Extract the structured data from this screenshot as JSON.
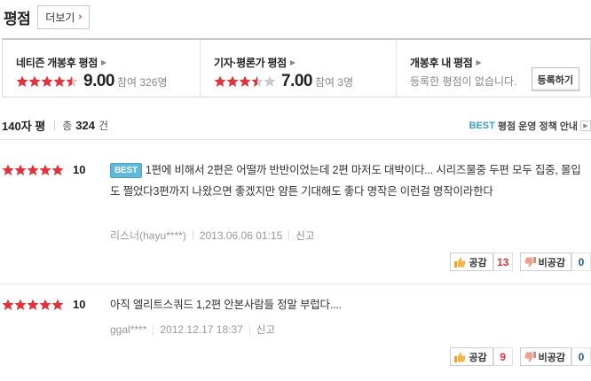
{
  "header": {
    "title": "평점",
    "more_label": "더보기"
  },
  "summary": {
    "netizen": {
      "label": "네티즌 개봉후 평점",
      "stars": 4.5,
      "score": "9.00",
      "count": "참여 326명"
    },
    "critic": {
      "label": "기자·평론가 평점",
      "stars": 3.5,
      "score": "7.00",
      "count": "참여 3명"
    },
    "mine": {
      "label": "개봉후 내 평점",
      "empty_text": "등록한 평점이 없습니다.",
      "register_label": "등록하기"
    }
  },
  "list": {
    "title": "140자 평",
    "total_prefix": "총",
    "total_count": "324",
    "total_suffix": "건",
    "policy_best": "BEST",
    "policy_text": "평점 운영 정책 안내"
  },
  "reviews": [
    {
      "stars": 5,
      "score": "10",
      "best_badge": "BEST",
      "text": "1편에 비해서 2편은 어떨까 반반이었는데 2편 마저도 대박이다... 시리즈물중 두편 모두 집중, 몰입도 쩔었다3편까지 나왔으면 좋겠지만 얌튼 기대해도 좋다 명작은 이런걸 명작이라한다",
      "author": "리스너(hayu****)",
      "date": "2013.06.06 01:15",
      "report": "신고",
      "like_label": "공감",
      "like_count": "13",
      "dislike_label": "비공감",
      "dislike_count": "0"
    },
    {
      "stars": 5,
      "score": "10",
      "text": "아직 엘리트스쿼드 1,2편 안본사람들 정말 부럽다....",
      "author": "ggal****",
      "date": "2012.12.17 18:37",
      "report": "신고",
      "like_label": "공감",
      "like_count": "9",
      "dislike_label": "비공감",
      "dislike_count": "0"
    }
  ],
  "colors": {
    "star_on": "#e2323b",
    "star_off": "#cccccc",
    "best_badge": "#5fb9d8",
    "like_count": "#e2323b",
    "dislike_count": "#2b5b85"
  },
  "icons": {
    "star": "star-icon",
    "thumb_up": "thumbs-up-icon",
    "thumb_down": "thumbs-down-icon",
    "chevron": "chevron-right-icon"
  }
}
